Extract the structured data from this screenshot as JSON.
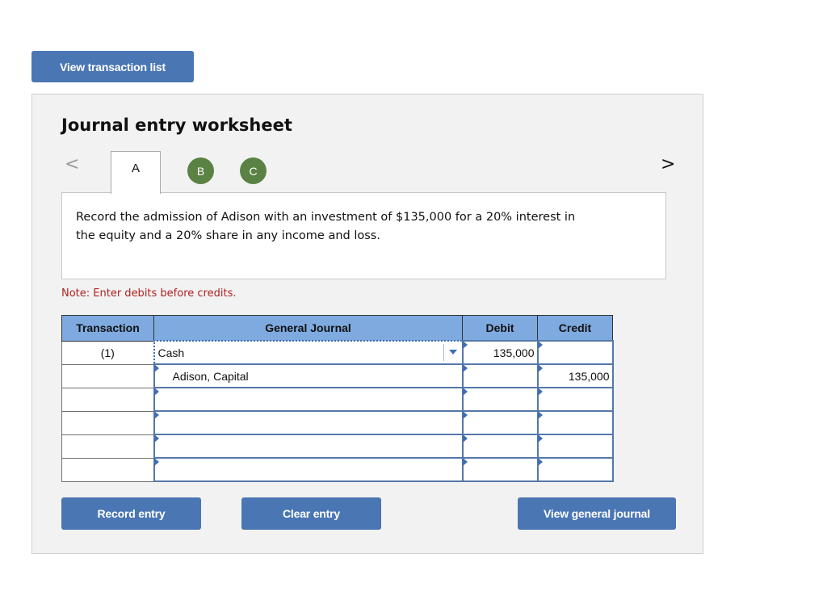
{
  "top_button": {
    "label": "View transaction list"
  },
  "worksheet": {
    "title": "Journal entry worksheet",
    "prev_icon": "chevron-left-icon",
    "next_icon": "chevron-right-icon",
    "prev_glyph": "<",
    "next_glyph": ">",
    "tabs": [
      {
        "label": "A",
        "active": true
      },
      {
        "label": "B",
        "completed": true
      },
      {
        "label": "C",
        "completed": true
      }
    ],
    "question": "Record the admission of Adison with an investment of $135,000 for a 20% interest in the equity and a 20% share in any income and loss.",
    "note": "Note: Enter debits before credits.",
    "colors": {
      "accent": "#4a76b4",
      "header": "#7eaadf",
      "tab_done": "#5a8244",
      "note": "#b02020"
    }
  },
  "journal": {
    "headers": {
      "transaction": "Transaction",
      "account": "General Journal",
      "debit": "Debit",
      "credit": "Credit"
    },
    "rows": [
      {
        "transaction": "(1)",
        "account": "Cash",
        "debit": "135,000",
        "credit": ""
      },
      {
        "transaction": "",
        "account": "Adison, Capital",
        "debit": "",
        "credit": "135,000"
      },
      {
        "transaction": "",
        "account": "",
        "debit": "",
        "credit": ""
      },
      {
        "transaction": "",
        "account": "",
        "debit": "",
        "credit": ""
      },
      {
        "transaction": "",
        "account": "",
        "debit": "",
        "credit": ""
      },
      {
        "transaction": "",
        "account": "",
        "debit": "",
        "credit": ""
      }
    ]
  },
  "buttons": {
    "record": "Record entry",
    "clear": "Clear entry",
    "view_journal": "View general journal"
  }
}
